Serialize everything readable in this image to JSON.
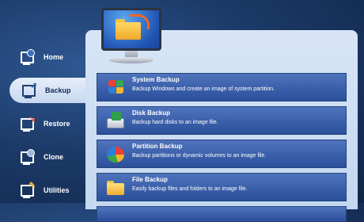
{
  "sidebar": {
    "items": [
      {
        "label": "Home",
        "icon": "home-icon",
        "active": false
      },
      {
        "label": "Backup",
        "icon": "backup-icon",
        "active": true
      },
      {
        "label": "Restore",
        "icon": "restore-icon",
        "active": false
      },
      {
        "label": "Clone",
        "icon": "clone-icon",
        "active": false
      },
      {
        "label": "Utilities",
        "icon": "utilities-icon",
        "active": false
      }
    ]
  },
  "main": {
    "header_icon": "monitor-folder-icon",
    "options": [
      {
        "title": "System Backup",
        "description": "Backup Windows and create an image of system partition.",
        "icon": "windows-flag-icon"
      },
      {
        "title": "Disk Backup",
        "description": "Backup hard disks to an image file.",
        "icon": "disk-icon"
      },
      {
        "title": "Partition Backup",
        "description": "Backup partitions or dynamic volumes to an image file.",
        "icon": "partition-pie-icon"
      },
      {
        "title": "File Backup",
        "description": "Easily backup files and folders to an image file.",
        "icon": "folder-icon"
      }
    ]
  },
  "colors": {
    "background": "#1c3a68",
    "panel": "#d7e5f6",
    "option_bar": "#3a61ad",
    "active_nav": "#dbe6f6"
  }
}
